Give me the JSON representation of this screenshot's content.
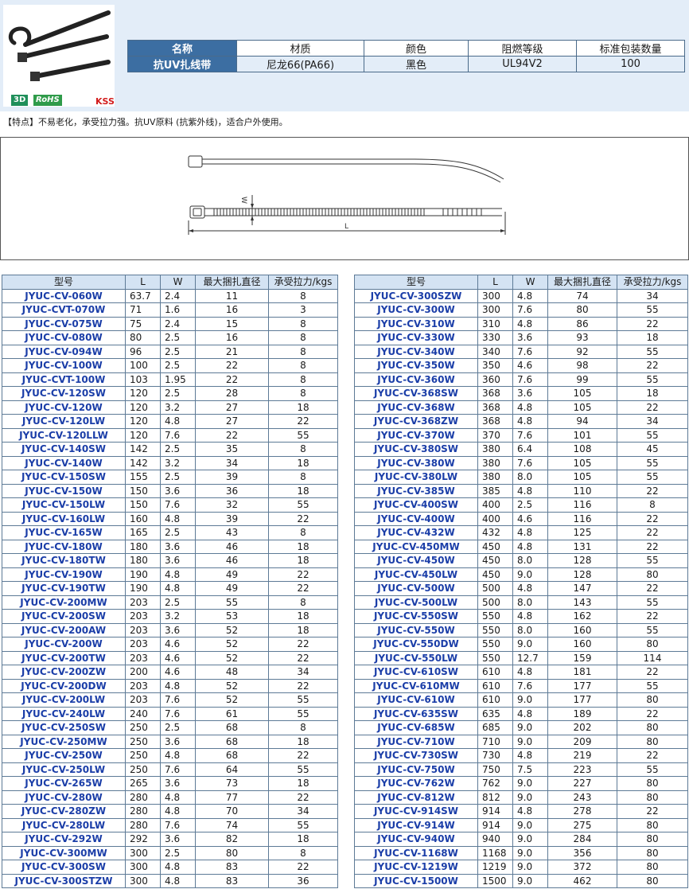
{
  "badges": {
    "three_d": "3D",
    "rohs": "RoHS",
    "kss": "KSS"
  },
  "spec": {
    "headers": [
      "名称",
      "材质",
      "颜色",
      "阻燃等级",
      "标准包装数量"
    ],
    "values": [
      "抗UV扎线带",
      "尼龙66(PA66)",
      "黑色",
      "UL94V2",
      "100"
    ]
  },
  "feature_text": "【特点】不易老化，承受拉力强。抗UV原料 (抗紫外线)，适合户外使用。",
  "drawing": {
    "w_label": "W",
    "l_label": "L"
  },
  "table_headers": [
    "型号",
    "L",
    "W",
    "最大捆扎直径",
    "承受拉力/kgs"
  ],
  "left_rows": [
    [
      "JYUC-CV-060W",
      "63.7",
      "2.4",
      "11",
      "8"
    ],
    [
      "JYUC-CVT-070W",
      "71",
      "1.6",
      "16",
      "3"
    ],
    [
      "JYUC-CV-075W",
      "75",
      "2.4",
      "15",
      "8"
    ],
    [
      "JYUC-CV-080W",
      "80",
      "2.5",
      "16",
      "8"
    ],
    [
      "JYUC-CV-094W",
      "96",
      "2.5",
      "21",
      "8"
    ],
    [
      "JYUC-CV-100W",
      "100",
      "2.5",
      "22",
      "8"
    ],
    [
      "JYUC-CVT-100W",
      "103",
      "1.95",
      "22",
      "8"
    ],
    [
      "JYUC-CV-120SW",
      "120",
      "2.5",
      "28",
      "8"
    ],
    [
      "JYUC-CV-120W",
      "120",
      "3.2",
      "27",
      "18"
    ],
    [
      "JYUC-CV-120LW",
      "120",
      "4.8",
      "27",
      "22"
    ],
    [
      "JYUC-CV-120LLW",
      "120",
      "7.6",
      "22",
      "55"
    ],
    [
      "JYUC-CV-140SW",
      "142",
      "2.5",
      "35",
      "8"
    ],
    [
      "JYUC-CV-140W",
      "142",
      "3.2",
      "34",
      "18"
    ],
    [
      "JYUC-CV-150SW",
      "155",
      "2.5",
      "39",
      "8"
    ],
    [
      "JYUC-CV-150W",
      "150",
      "3.6",
      "36",
      "18"
    ],
    [
      "JYUC-CV-150LW",
      "150",
      "7.6",
      "32",
      "55"
    ],
    [
      "JYUC-CV-160LW",
      "160",
      "4.8",
      "39",
      "22"
    ],
    [
      "JYUC-CV-165W",
      "165",
      "2.5",
      "43",
      "8"
    ],
    [
      "JYUC-CV-180W",
      "180",
      "3.6",
      "46",
      "18"
    ],
    [
      "JYUC-CV-180TW",
      "180",
      "3.6",
      "46",
      "18"
    ],
    [
      "JYUC-CV-190W",
      "190",
      "4.8",
      "49",
      "22"
    ],
    [
      "JYUC-CV-190TW",
      "190",
      "4.8",
      "49",
      "22"
    ],
    [
      "JYUC-CV-200MW",
      "203",
      "2.5",
      "55",
      "8"
    ],
    [
      "JYUC-CV-200SW",
      "203",
      "3.2",
      "53",
      "18"
    ],
    [
      "JYUC-CV-200AW",
      "203",
      "3.6",
      "52",
      "18"
    ],
    [
      "JYUC-CV-200W",
      "203",
      "4.6",
      "52",
      "22"
    ],
    [
      "JYUC-CV-200TW",
      "203",
      "4.6",
      "52",
      "22"
    ],
    [
      "JYUC-CV-200ZW",
      "200",
      "4.6",
      "48",
      "34"
    ],
    [
      "JYUC-CV-200DW",
      "203",
      "4.8",
      "52",
      "22"
    ],
    [
      "JYUC-CV-200LW",
      "203",
      "7.6",
      "52",
      "55"
    ],
    [
      "JYUC-CV-240LW",
      "240",
      "7.6",
      "61",
      "55"
    ],
    [
      "JYUC-CV-250SW",
      "250",
      "2.5",
      "68",
      "8"
    ],
    [
      "JYUC-CV-250MW",
      "250",
      "3.6",
      "68",
      "18"
    ],
    [
      "JYUC-CV-250W",
      "250",
      "4.8",
      "68",
      "22"
    ],
    [
      "JYUC-CV-250LW",
      "250",
      "7.6",
      "64",
      "55"
    ],
    [
      "JYUC-CV-265W",
      "265",
      "3.6",
      "73",
      "18"
    ],
    [
      "JYUC-CV-280W",
      "280",
      "4.8",
      "77",
      "22"
    ],
    [
      "JYUC-CV-280ZW",
      "280",
      "4.8",
      "70",
      "34"
    ],
    [
      "JYUC-CV-280LW",
      "280",
      "7.6",
      "74",
      "55"
    ],
    [
      "JYUC-CV-292W",
      "292",
      "3.6",
      "82",
      "18"
    ],
    [
      "JYUC-CV-300MW",
      "300",
      "2.5",
      "80",
      "8"
    ],
    [
      "JYUC-CV-300SW",
      "300",
      "4.8",
      "83",
      "22"
    ],
    [
      "JYUC-CV-300STZW",
      "300",
      "4.8",
      "83",
      "36"
    ]
  ],
  "right_rows": [
    [
      "JYUC-CV-300SZW",
      "300",
      "4.8",
      "74",
      "34"
    ],
    [
      "JYUC-CV-300W",
      "300",
      "7.6",
      "80",
      "55"
    ],
    [
      "JYUC-CV-310W",
      "310",
      "4.8",
      "86",
      "22"
    ],
    [
      "JYUC-CV-330W",
      "330",
      "3.6",
      "93",
      "18"
    ],
    [
      "JYUC-CV-340W",
      "340",
      "7.6",
      "92",
      "55"
    ],
    [
      "JYUC-CV-350W",
      "350",
      "4.6",
      "98",
      "22"
    ],
    [
      "JYUC-CV-360W",
      "360",
      "7.6",
      "99",
      "55"
    ],
    [
      "JYUC-CV-368SW",
      "368",
      "3.6",
      "105",
      "18"
    ],
    [
      "JYUC-CV-368W",
      "368",
      "4.8",
      "105",
      "22"
    ],
    [
      "JYUC-CV-368ZW",
      "368",
      "4.8",
      "94",
      "34"
    ],
    [
      "JYUC-CV-370W",
      "370",
      "7.6",
      "101",
      "55"
    ],
    [
      "JYUC-CV-380SW",
      "380",
      "6.4",
      "108",
      "45"
    ],
    [
      "JYUC-CV-380W",
      "380",
      "7.6",
      "105",
      "55"
    ],
    [
      "JYUC-CV-380LW",
      "380",
      "8.0",
      "105",
      "55"
    ],
    [
      "JYUC-CV-385W",
      "385",
      "4.8",
      "110",
      "22"
    ],
    [
      "JYUC-CV-400SW",
      "400",
      "2.5",
      "116",
      "8"
    ],
    [
      "JYUC-CV-400W",
      "400",
      "4.6",
      "116",
      "22"
    ],
    [
      "JYUC-CV-432W",
      "432",
      "4.8",
      "125",
      "22"
    ],
    [
      "JYUC-CV-450MW",
      "450",
      "4.8",
      "131",
      "22"
    ],
    [
      "JYUC-CV-450W",
      "450",
      "8.0",
      "128",
      "55"
    ],
    [
      "JYUC-CV-450LW",
      "450",
      "9.0",
      "128",
      "80"
    ],
    [
      "JYUC-CV-500W",
      "500",
      "4.8",
      "147",
      "22"
    ],
    [
      "JYUC-CV-500LW",
      "500",
      "8.0",
      "143",
      "55"
    ],
    [
      "JYUC-CV-550SW",
      "550",
      "4.8",
      "162",
      "22"
    ],
    [
      "JYUC-CV-550W",
      "550",
      "8.0",
      "160",
      "55"
    ],
    [
      "JYUC-CV-550DW",
      "550",
      "9.0",
      "160",
      "80"
    ],
    [
      "JYUC-CV-550LW",
      "550",
      "12.7",
      "159",
      "114"
    ],
    [
      "JYUC-CV-610SW",
      "610",
      "4.8",
      "181",
      "22"
    ],
    [
      "JYUC-CV-610MW",
      "610",
      "7.6",
      "177",
      "55"
    ],
    [
      "JYUC-CV-610W",
      "610",
      "9.0",
      "177",
      "80"
    ],
    [
      "JYUC-CV-635SW",
      "635",
      "4.8",
      "189",
      "22"
    ],
    [
      "JYUC-CV-685W",
      "685",
      "9.0",
      "202",
      "80"
    ],
    [
      "JYUC-CV-710W",
      "710",
      "9.0",
      "209",
      "80"
    ],
    [
      "JYUC-CV-730SW",
      "730",
      "4.8",
      "219",
      "22"
    ],
    [
      "JYUC-CV-750W",
      "750",
      "7.5",
      "223",
      "55"
    ],
    [
      "JYUC-CV-762W",
      "762",
      "9.0",
      "227",
      "80"
    ],
    [
      "JYUC-CV-812W",
      "812",
      "9.0",
      "243",
      "80"
    ],
    [
      "JYUC-CV-914SW",
      "914",
      "4.8",
      "278",
      "22"
    ],
    [
      "JYUC-CV-914W",
      "914",
      "9.0",
      "275",
      "80"
    ],
    [
      "JYUC-CV-940W",
      "940",
      "9.0",
      "284",
      "80"
    ],
    [
      "JYUC-CV-1168W",
      "1168",
      "9.0",
      "356",
      "80"
    ],
    [
      "JYUC-CV-1219W",
      "1219",
      "9.0",
      "372",
      "80"
    ],
    [
      "JYUC-CV-1500W",
      "1500",
      "9.0",
      "462",
      "80"
    ]
  ]
}
